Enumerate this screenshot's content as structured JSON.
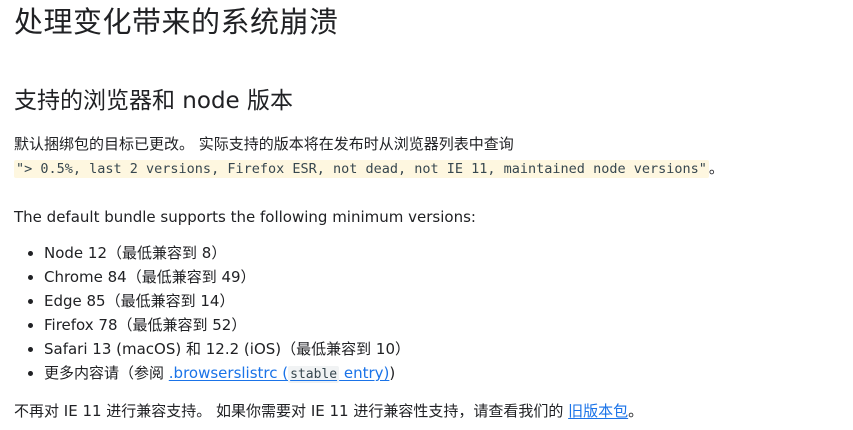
{
  "page_title": "处理变化带来的系统崩溃",
  "section": {
    "heading": "支持的浏览器和 node 版本",
    "intro_text": "默认捆绑包的目标已更改。 实际支持的版本将在发布时从浏览器列表中查询",
    "query_code": "\"> 0.5%, last 2 versions, Firefox ESR, not dead, not IE 11, maintained node versions\"",
    "query_suffix": "。",
    "default_text": "The default bundle supports the following minimum versions:",
    "versions": [
      "Node 12（最低兼容到 8）",
      "Chrome 84（最低兼容到 49）",
      "Edge 85（最低兼容到 14）",
      "Firefox 78（最低兼容到 52）",
      "Safari 13 (macOS) 和 12.2 (iOS)（最低兼容到 10）"
    ],
    "more_prefix": "更多内容请（参阅 ",
    "more_link_text": ".browserslistrc (",
    "more_link_code": "stable",
    "more_link_tail": " entry)",
    "more_suffix": ")",
    "ie_text": "不再对 IE 11 进行兼容支持。 如果你需要对 IE 11 进行兼容性支持，请查看我们的 ",
    "ie_link": "旧版本包",
    "ie_suffix": "。"
  }
}
